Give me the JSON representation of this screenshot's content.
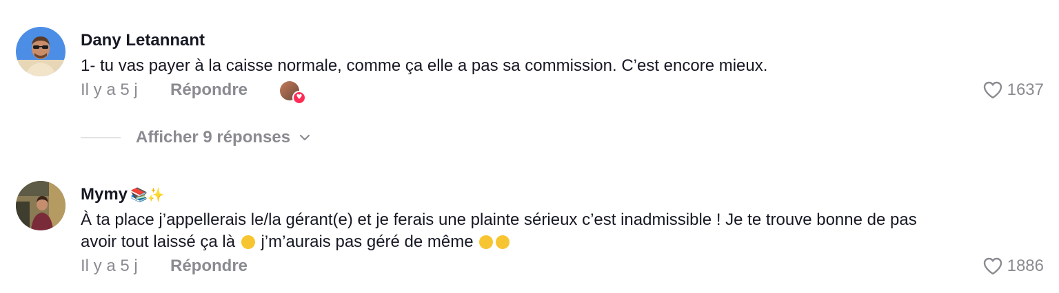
{
  "comments": [
    {
      "username": "Dany Letannant",
      "text": "1- tu vas payer à la caisse normale, comme ça elle a pas sa commission. C’est encore mieux.",
      "time": "Il y a 5 j",
      "reply_label": "Répondre",
      "likes": "1637",
      "avatar_icon": "avatar-man-sunglasses",
      "liked_by_creator": true
    },
    {
      "username": "Mymy",
      "username_emoji": "📚✨",
      "text_line1": "À ta place j’appellerais le/la gérant(e) et je ferais une plainte sérieux c’est inadmissible ! Je te trouve bonne de pas",
      "text_line2a": "avoir tout laissé ça là",
      "text_line2b": "j’m’aurais pas géré de même",
      "time": "Il y a 5 j",
      "reply_label": "Répondre",
      "likes": "1886",
      "avatar_icon": "avatar-woman-photo"
    }
  ],
  "view_replies": {
    "label": "Afficher 9 réponses"
  },
  "colors": {
    "text": "#161823",
    "muted": "#8a8b91",
    "heart_accent": "#fe2c55"
  }
}
